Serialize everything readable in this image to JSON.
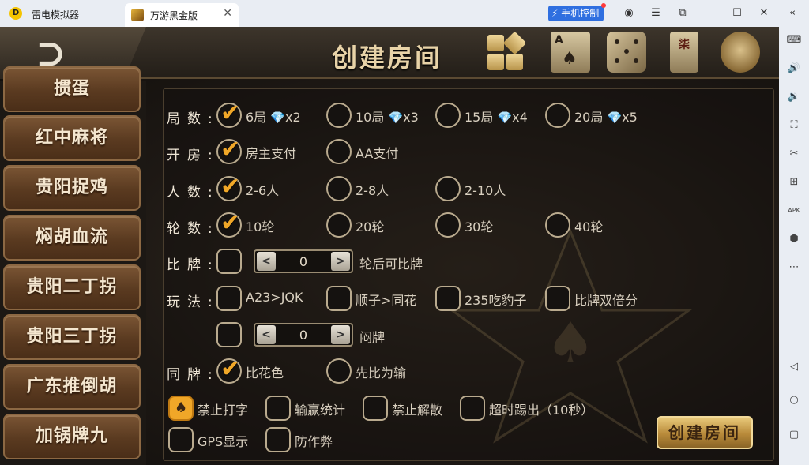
{
  "window": {
    "app_name": "雷电模拟器",
    "tab_title": "万游黑金版",
    "phone_control_label": "手机控制"
  },
  "header": {
    "title": "创建房间",
    "card_letter": "A",
    "mahjong_char": "柒"
  },
  "game_menu": [
    "掼蛋",
    "红中麻将",
    "贵阳捉鸡",
    "焖胡血流",
    "贵阳二丁拐",
    "贵阳三丁拐",
    "广东推倒胡",
    "加锅牌九"
  ],
  "rows": {
    "rounds": {
      "label": "局数:",
      "options": [
        {
          "text": "6局",
          "cost": "x2",
          "checked": true
        },
        {
          "text": "10局",
          "cost": "x3",
          "checked": false
        },
        {
          "text": "15局",
          "cost": "x4",
          "checked": false
        },
        {
          "text": "20局",
          "cost": "x5",
          "checked": false
        }
      ]
    },
    "room_pay": {
      "label": "开房:",
      "options": [
        {
          "text": "房主支付",
          "checked": true
        },
        {
          "text": "AA支付",
          "checked": false
        }
      ]
    },
    "players": {
      "label": "人数:",
      "options": [
        {
          "text": "2-6人",
          "checked": true
        },
        {
          "text": "2-8人",
          "checked": false
        },
        {
          "text": "2-10人",
          "checked": false
        }
      ]
    },
    "turns": {
      "label": "轮数:",
      "options": [
        {
          "text": "10轮",
          "checked": true
        },
        {
          "text": "20轮",
          "checked": false
        },
        {
          "text": "30轮",
          "checked": false
        },
        {
          "text": "40轮",
          "checked": false
        }
      ]
    },
    "compare": {
      "label": "比牌:",
      "stepper_value": "0",
      "caption": "轮后可比牌"
    },
    "play_style": {
      "label": "玩法:",
      "options": [
        {
          "text": "A23>JQK",
          "checked": false
        },
        {
          "text": "顺子>同花",
          "checked": false
        },
        {
          "text": "235吃豹子",
          "checked": false
        },
        {
          "text": "比牌双倍分",
          "checked": false
        }
      ],
      "stepper_value": "0",
      "caption": "闷牌"
    },
    "same_cards": {
      "label": "同牌:",
      "options": [
        {
          "text": "比花色",
          "checked": true
        },
        {
          "text": "先比为输",
          "checked": false
        }
      ]
    },
    "extras": [
      {
        "text": "禁止打字",
        "checked": true
      },
      {
        "text": "输赢统计",
        "checked": false
      },
      {
        "text": "禁止解散",
        "checked": false
      },
      {
        "text": "超时踢出（10秒）",
        "checked": false
      },
      {
        "text": "GPS显示",
        "checked": false
      },
      {
        "text": "防作弊",
        "checked": false
      }
    ]
  },
  "create_button": "创建房间",
  "colors": {
    "accent_gold": "#f0a728",
    "gem_blue": "#5bb7ff",
    "phone_control_blue": "#2f6fe0"
  }
}
